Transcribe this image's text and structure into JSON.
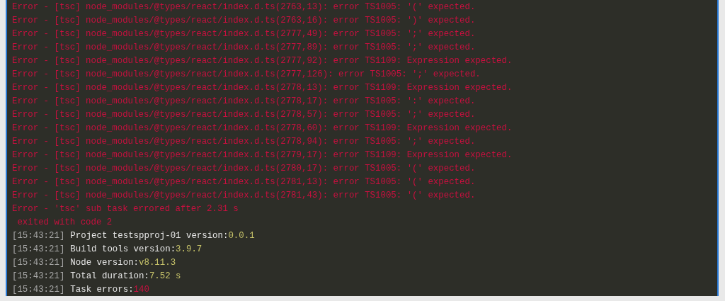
{
  "terminal": {
    "error_lines": [
      "Error - [tsc] node_modules/@types/react/index.d.ts(2763,13): error TS1005: '(' expected.",
      "Error - [tsc] node_modules/@types/react/index.d.ts(2763,16): error TS1005: ')' expected.",
      "Error - [tsc] node_modules/@types/react/index.d.ts(2777,49): error TS1005: ';' expected.",
      "Error - [tsc] node_modules/@types/react/index.d.ts(2777,89): error TS1005: ';' expected.",
      "Error - [tsc] node_modules/@types/react/index.d.ts(2777,92): error TS1109: Expression expected.",
      "Error - [tsc] node_modules/@types/react/index.d.ts(2777,126): error TS1005: ';' expected.",
      "Error - [tsc] node_modules/@types/react/index.d.ts(2778,13): error TS1109: Expression expected.",
      "Error - [tsc] node_modules/@types/react/index.d.ts(2778,17): error TS1005: ':' expected.",
      "Error - [tsc] node_modules/@types/react/index.d.ts(2778,57): error TS1005: ';' expected.",
      "Error - [tsc] node_modules/@types/react/index.d.ts(2778,60): error TS1109: Expression expected.",
      "Error - [tsc] node_modules/@types/react/index.d.ts(2778,94): error TS1005: ';' expected.",
      "Error - [tsc] node_modules/@types/react/index.d.ts(2779,17): error TS1109: Expression expected.",
      "Error - [tsc] node_modules/@types/react/index.d.ts(2780,17): error TS1005: '(' expected.",
      "Error - [tsc] node_modules/@types/react/index.d.ts(2781,13): error TS1005: '(' expected.",
      "Error - [tsc] node_modules/@types/react/index.d.ts(2781,43): error TS1005: '(' expected.",
      "Error - 'tsc' sub task errored after 2.31 s",
      " exited with code 2"
    ],
    "info_lines": [
      {
        "time": "[15:43:21]",
        "label": "Project testspproj-01 version:",
        "value": "0.0.1",
        "color": "#c8c46a"
      },
      {
        "time": "[15:43:21]",
        "label": "Build tools version:",
        "value": "3.9.7",
        "color": "#c8c46a"
      },
      {
        "time": "[15:43:21]",
        "label": "Node version:",
        "value": "v8.11.3",
        "color": "#c8c46a"
      },
      {
        "time": "[15:43:21]",
        "label": "Total duration:",
        "value": "7.52 s",
        "color": "#c8c46a"
      },
      {
        "time": "[15:43:21]",
        "label": "Task errors:",
        "value": "140",
        "color": "#c8103f"
      }
    ]
  }
}
